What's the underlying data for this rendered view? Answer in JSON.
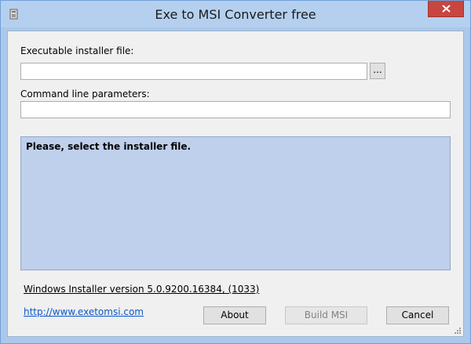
{
  "window": {
    "title": "Exe to MSI Converter free"
  },
  "form": {
    "exe_label": "Executable installer file:",
    "exe_value": "",
    "browse_label": "...",
    "params_label": "Command line parameters:",
    "params_value": ""
  },
  "status": {
    "message": "Please, select the installer file."
  },
  "footer": {
    "version_text": "Windows Installer version 5.0.9200.16384, (1033)",
    "link_text": "http://www.exetomsi.com",
    "about_label": "About",
    "build_label": "Build MSI",
    "cancel_label": "Cancel"
  },
  "colors": {
    "titlebar": "#b5d0ef",
    "close": "#c7463f",
    "status_bg": "#bfd0ec",
    "link": "#0b57c6"
  }
}
